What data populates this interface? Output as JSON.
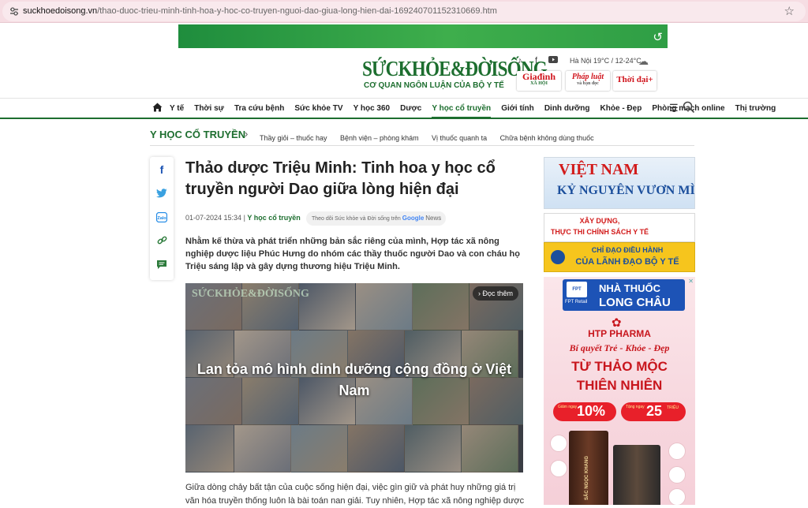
{
  "browser": {
    "url_domain": "suckhoedoisong.vn",
    "url_path": "/thao-duoc-trieu-minh-tinh-hoa-y-hoc-co-truyen-nguoi-dao-giua-long-hien-dai-169240701152310669.htm",
    "site_info_icon": "tune-icon",
    "bookmark_icon": "star-icon"
  },
  "header": {
    "logo_text": "SỨCKHỎE&ĐỜISỐNG",
    "logo_sub": "CƠ QUAN NGÔN LUẬN CỦA BỘ Y TẾ",
    "socials": [
      "tiktok-icon",
      "facebook-icon",
      "youtube-icon"
    ],
    "weather": "Hà Nội 19°C / 12-24°C",
    "weather_icon": "cloud-icon",
    "partners": {
      "p1_main": "Giađình",
      "p1_sub": "XÃ HỘI",
      "p2_main": "Pháp luật",
      "p2_sub": "và bạn đọc",
      "p3": "Thời đại"
    }
  },
  "nav": {
    "home_icon": "home-icon",
    "items": [
      "Y tế",
      "Thời sự",
      "Tra cứu bệnh",
      "Sức khỏe TV",
      "Y học 360",
      "Dược",
      "Y học cổ truyền",
      "Giới tính",
      "Dinh dưỡng",
      "Khỏe - Đẹp",
      "Phòng mạch online",
      "Thị trường"
    ],
    "active": "Y học cổ truyền"
  },
  "section": {
    "title": "Y HỌC CỔ TRUYỀN",
    "subs": [
      "Thầy giỏi – thuốc hay",
      "Bệnh viện – phòng khám",
      "Vị thuốc quanh ta",
      "Chữa bệnh không dùng thuốc"
    ]
  },
  "share": [
    "facebook-icon",
    "twitter-icon",
    "zalo-icon",
    "link-icon",
    "comment-icon"
  ],
  "article": {
    "title": "Thảo dược Triệu Minh: Tinh hoa y học cổ truyền người Dao giữa lòng hiện đại",
    "datetime": "01-07-2024 15:34",
    "sep": " | ",
    "category": "Y học cổ truyền",
    "gnews_prefix": "Theo dõi Sức khỏe và Đời sống trên",
    "gnews_brand": "Google",
    "gnews_suffix": "News",
    "sapo": "Nhằm kế thừa và phát triển những bản sắc riêng của mình, Hợp tác xã nông nghiệp dược liệu Phúc Hưng do nhóm các thầy thuốc người Dao và con cháu họ Triệu sáng lập và gây dựng thương hiệu Triệu Minh.",
    "video": {
      "read_more": "› Đọc thêm",
      "caption": "Lan tỏa mô hình dinh dưỡng cộng đồng ở Việt Nam",
      "watermark": "SỨCKHỎE&ĐỜISỐNG"
    },
    "body": "Giữa dòng chảy bất tận của cuộc sống hiện đại, việc gìn giữ và phát huy những giá trị văn hóa truyền thống luôn là bài toán nan giải. Tuy nhiên, Hợp tác xã nông nghiệp dược"
  },
  "sidebar": {
    "ad1": {
      "l1": "VIỆT NAM",
      "l2": "KỶ NGUYÊN VƯƠN MÌNH"
    },
    "ad2": {
      "l1": "XÂY DỰNG,",
      "l2": "THỰC THI CHÍNH SÁCH Y TẾ"
    },
    "ad3": {
      "l1": "CHỈ ĐẠO ĐIỀU HÀNH",
      "l2": "CỦA LÃNH ĐẠO BỘ Y TẾ"
    },
    "ad4": {
      "fpt": "FPT",
      "fpt_retail": "FPT Retail",
      "lc1": "NHÀ THUỐC",
      "lc2": "LONG CHÂU",
      "htp": "HTP PHARMA",
      "slogan": "Bí quyết Trẻ - Khỏe - Đẹp",
      "h1": "TỪ THẢO MỘC",
      "h2": "THIÊN NHIÊN",
      "promo1_small": "Giảm ngay",
      "promo1_big": "10%",
      "promo2_small": "Tặng ngay",
      "promo2_big": "25",
      "promo2_unit": "TRIỆU",
      "prod_label": "SẮC NGỌC KHANG"
    }
  }
}
